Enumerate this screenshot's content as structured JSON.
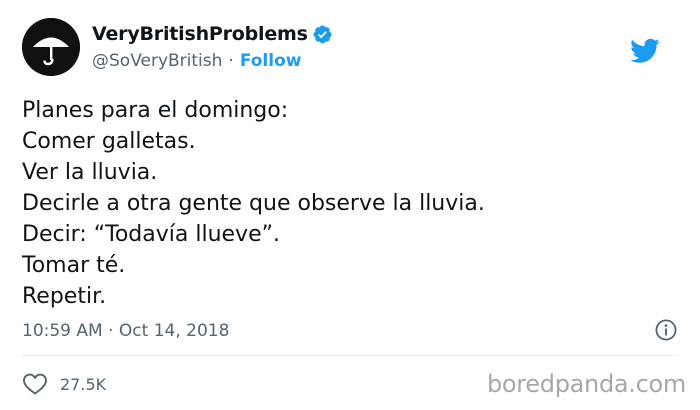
{
  "author": {
    "display_name": "VeryBritishProblems",
    "handle": "@SoVeryBritish",
    "separator": "·",
    "follow_label": "Follow",
    "avatar_icon": "umbrella-icon",
    "verified_icon": "verified-badge-icon"
  },
  "tweet": {
    "lines": [
      "Planes para el domingo:",
      "Comer galletas.",
      "Ver la lluvia.",
      "Decirle a otra gente que observe la lluvia.",
      "Decir: “Todavía llueve”.",
      "Tomar té.",
      "Repetir."
    ],
    "timestamp": "10:59 AM · Oct 14, 2018",
    "likes": "27.5K"
  },
  "watermark": "boredpanda.com",
  "colors": {
    "accent": "#1d9bf0",
    "text": "#0f1419",
    "muted": "#536471",
    "divider": "#e6ecf0",
    "watermark": "#a8a8a8"
  }
}
